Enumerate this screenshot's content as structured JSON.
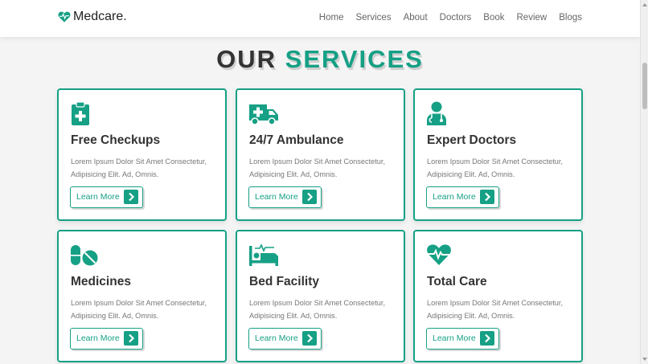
{
  "brand": {
    "name": "Medcare.",
    "accent": "#16a085"
  },
  "nav": [
    "Home",
    "Services",
    "About",
    "Doctors",
    "Book",
    "Review",
    "Blogs"
  ],
  "heading": {
    "word1": "OUR",
    "word2": "SERVICES"
  },
  "cards": [
    {
      "icon": "clipboard-medical-icon",
      "title": "Free Checkups",
      "desc": "Lorem Ipsum Dolor Sit Amet Consectetur, Adipisicing Elit. Ad, Omnis.",
      "button": "Learn More"
    },
    {
      "icon": "ambulance-icon",
      "title": "24/7 Ambulance",
      "desc": "Lorem Ipsum Dolor Sit Amet Consectetur, Adipisicing Elit. Ad, Omnis.",
      "button": "Learn More"
    },
    {
      "icon": "doctor-icon",
      "title": "Expert Doctors",
      "desc": "Lorem Ipsum Dolor Sit Amet Consectetur, Adipisicing Elit. Ad, Omnis.",
      "button": "Learn More"
    },
    {
      "icon": "pills-icon",
      "title": "Medicines",
      "desc": "Lorem Ipsum Dolor Sit Amet Consectetur, Adipisicing Elit. Ad, Omnis.",
      "button": "Learn More"
    },
    {
      "icon": "bed-icon",
      "title": "Bed Facility",
      "desc": "Lorem Ipsum Dolor Sit Amet Consectetur, Adipisicing Elit. Ad, Omnis.",
      "button": "Learn More"
    },
    {
      "icon": "heartbeat-icon",
      "title": "Total Care",
      "desc": "Lorem Ipsum Dolor Sit Amet Consectetur, Adipisicing Elit. Ad, Omnis.",
      "button": "Learn More"
    }
  ]
}
